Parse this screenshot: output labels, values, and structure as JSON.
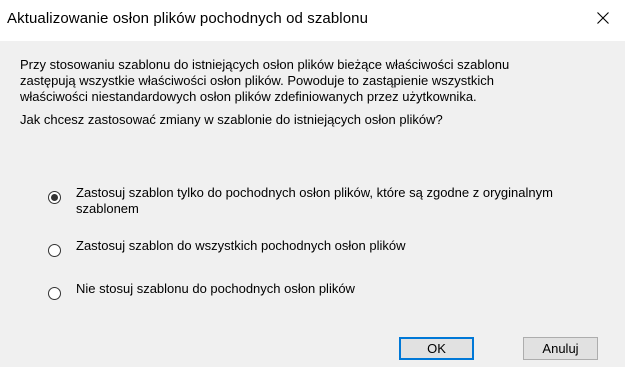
{
  "window": {
    "title": "Aktualizowanie osłon plików pochodnych od szablonu",
    "close_icon": "close-icon"
  },
  "content": {
    "description": "Przy stosowaniu szablonu do istniejących osłon plików bieżące właściwości szablonu zastępują wszystkie właściwości osłon plików. Powoduje to zastąpienie wszystkich właściwości niestandardowych osłon plików zdefiniowanych przez użytkownika.",
    "question": "Jak chcesz zastosować zmiany w szablonie do istniejących osłon plików?"
  },
  "options": [
    {
      "label": "Zastosuj szablon tylko do pochodnych osłon plików, które są zgodne z oryginalnym szablonem",
      "selected": true
    },
    {
      "label": "Zastosuj szablon do wszystkich pochodnych osłon plików",
      "selected": false
    },
    {
      "label": "Nie stosuj szablonu do pochodnych osłon plików",
      "selected": false
    }
  ],
  "buttons": {
    "ok_label": "OK",
    "cancel_label": "Anuluj"
  },
  "colors": {
    "dialog_background": "#f0f0f0",
    "titlebar_background": "#ffffff",
    "default_button_border": "#0078d7"
  }
}
